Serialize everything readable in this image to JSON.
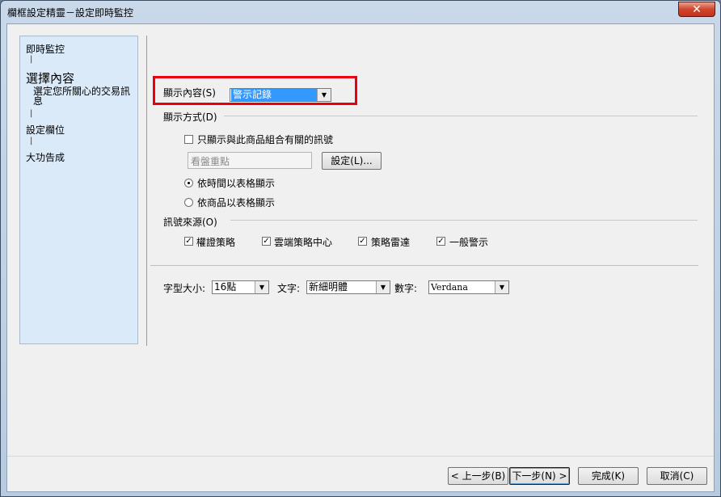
{
  "window": {
    "title": "欄框設定精靈－設定即時監控",
    "close_symbol": "✕"
  },
  "steps": {
    "item1": "即時監控",
    "item2": "選擇內容",
    "item2_desc": "選定您所關心的交易訊息",
    "item3": "設定欄位",
    "item4": "大功告成",
    "separator": "|"
  },
  "display_content": {
    "label": "顯示內容(S)",
    "value": "警示記錄"
  },
  "display_mode": {
    "label": "顯示方式(D)",
    "only_related_label": "只顯示與此商品組合有關的訊號",
    "group_field_value": "看盤重點",
    "settings_button": "設定(L)...",
    "radio_time": "依時間以表格顯示",
    "radio_product": "依商品以表格顯示"
  },
  "signal_source": {
    "label": "訊號來源(O)",
    "items": [
      "權證策略",
      "雲端策略中心",
      "策略雷達",
      "一般警示"
    ]
  },
  "font": {
    "size_label": "字型大小:",
    "size_value": "16點",
    "text_label": "文字:",
    "text_value": "新細明體",
    "number_label": "數字:",
    "number_value": "Verdana"
  },
  "buttons": {
    "prev": "< 上一步(B)",
    "next": "下一步(N) >",
    "finish": "完成(K)",
    "cancel": "取消(C)"
  },
  "glyphs": {
    "check": "✓",
    "arrow": "▼"
  }
}
